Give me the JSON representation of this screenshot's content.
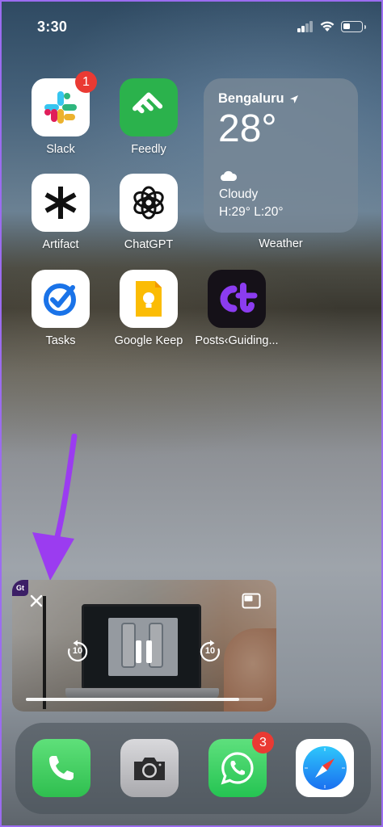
{
  "status_bar": {
    "time": "3:30"
  },
  "apps": [
    {
      "id": "slack",
      "label": "Slack",
      "badge": "1"
    },
    {
      "id": "feedly",
      "label": "Feedly"
    },
    {
      "id": "artifact",
      "label": "Artifact"
    },
    {
      "id": "chatgpt",
      "label": "ChatGPT"
    },
    {
      "id": "tasks",
      "label": "Tasks"
    },
    {
      "id": "keep",
      "label": "Google Keep"
    },
    {
      "id": "posts",
      "label": "Posts‹Guiding..."
    }
  ],
  "weather_widget": {
    "city": "Bengaluru",
    "temperature": "28°",
    "condition": "Cloudy",
    "high_low": "H:29° L:20°",
    "label": "Weather"
  },
  "pip_player": {
    "logo_text": "Gt",
    "skip_back": "10",
    "skip_forward": "10",
    "progress": 0.9
  },
  "dock": [
    {
      "id": "phone"
    },
    {
      "id": "camera"
    },
    {
      "id": "whatsapp",
      "badge": "3"
    },
    {
      "id": "safari"
    }
  ],
  "colors": {
    "badge": "#ea3a33",
    "annotation_arrow": "#9b3cf0",
    "slack_bg": "#ffffff",
    "feedly_bg": "#2bb24c",
    "whatsapp_bg": "#25d366",
    "phone_bg": "#34c759"
  }
}
